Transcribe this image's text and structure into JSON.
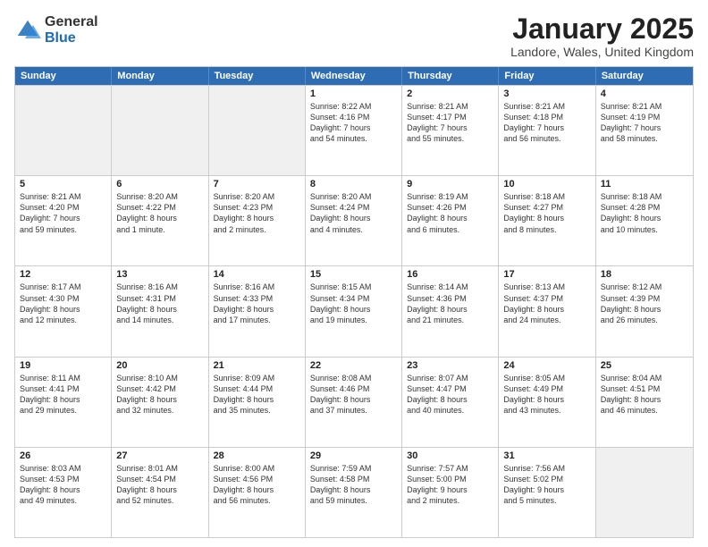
{
  "logo": {
    "general": "General",
    "blue": "Blue"
  },
  "title": "January 2025",
  "location": "Landore, Wales, United Kingdom",
  "days": [
    "Sunday",
    "Monday",
    "Tuesday",
    "Wednesday",
    "Thursday",
    "Friday",
    "Saturday"
  ],
  "weeks": [
    [
      {
        "day": "",
        "text": ""
      },
      {
        "day": "",
        "text": ""
      },
      {
        "day": "",
        "text": ""
      },
      {
        "day": "1",
        "text": "Sunrise: 8:22 AM\nSunset: 4:16 PM\nDaylight: 7 hours\nand 54 minutes."
      },
      {
        "day": "2",
        "text": "Sunrise: 8:21 AM\nSunset: 4:17 PM\nDaylight: 7 hours\nand 55 minutes."
      },
      {
        "day": "3",
        "text": "Sunrise: 8:21 AM\nSunset: 4:18 PM\nDaylight: 7 hours\nand 56 minutes."
      },
      {
        "day": "4",
        "text": "Sunrise: 8:21 AM\nSunset: 4:19 PM\nDaylight: 7 hours\nand 58 minutes."
      }
    ],
    [
      {
        "day": "5",
        "text": "Sunrise: 8:21 AM\nSunset: 4:20 PM\nDaylight: 7 hours\nand 59 minutes."
      },
      {
        "day": "6",
        "text": "Sunrise: 8:20 AM\nSunset: 4:22 PM\nDaylight: 8 hours\nand 1 minute."
      },
      {
        "day": "7",
        "text": "Sunrise: 8:20 AM\nSunset: 4:23 PM\nDaylight: 8 hours\nand 2 minutes."
      },
      {
        "day": "8",
        "text": "Sunrise: 8:20 AM\nSunset: 4:24 PM\nDaylight: 8 hours\nand 4 minutes."
      },
      {
        "day": "9",
        "text": "Sunrise: 8:19 AM\nSunset: 4:26 PM\nDaylight: 8 hours\nand 6 minutes."
      },
      {
        "day": "10",
        "text": "Sunrise: 8:18 AM\nSunset: 4:27 PM\nDaylight: 8 hours\nand 8 minutes."
      },
      {
        "day": "11",
        "text": "Sunrise: 8:18 AM\nSunset: 4:28 PM\nDaylight: 8 hours\nand 10 minutes."
      }
    ],
    [
      {
        "day": "12",
        "text": "Sunrise: 8:17 AM\nSunset: 4:30 PM\nDaylight: 8 hours\nand 12 minutes."
      },
      {
        "day": "13",
        "text": "Sunrise: 8:16 AM\nSunset: 4:31 PM\nDaylight: 8 hours\nand 14 minutes."
      },
      {
        "day": "14",
        "text": "Sunrise: 8:16 AM\nSunset: 4:33 PM\nDaylight: 8 hours\nand 17 minutes."
      },
      {
        "day": "15",
        "text": "Sunrise: 8:15 AM\nSunset: 4:34 PM\nDaylight: 8 hours\nand 19 minutes."
      },
      {
        "day": "16",
        "text": "Sunrise: 8:14 AM\nSunset: 4:36 PM\nDaylight: 8 hours\nand 21 minutes."
      },
      {
        "day": "17",
        "text": "Sunrise: 8:13 AM\nSunset: 4:37 PM\nDaylight: 8 hours\nand 24 minutes."
      },
      {
        "day": "18",
        "text": "Sunrise: 8:12 AM\nSunset: 4:39 PM\nDaylight: 8 hours\nand 26 minutes."
      }
    ],
    [
      {
        "day": "19",
        "text": "Sunrise: 8:11 AM\nSunset: 4:41 PM\nDaylight: 8 hours\nand 29 minutes."
      },
      {
        "day": "20",
        "text": "Sunrise: 8:10 AM\nSunset: 4:42 PM\nDaylight: 8 hours\nand 32 minutes."
      },
      {
        "day": "21",
        "text": "Sunrise: 8:09 AM\nSunset: 4:44 PM\nDaylight: 8 hours\nand 35 minutes."
      },
      {
        "day": "22",
        "text": "Sunrise: 8:08 AM\nSunset: 4:46 PM\nDaylight: 8 hours\nand 37 minutes."
      },
      {
        "day": "23",
        "text": "Sunrise: 8:07 AM\nSunset: 4:47 PM\nDaylight: 8 hours\nand 40 minutes."
      },
      {
        "day": "24",
        "text": "Sunrise: 8:05 AM\nSunset: 4:49 PM\nDaylight: 8 hours\nand 43 minutes."
      },
      {
        "day": "25",
        "text": "Sunrise: 8:04 AM\nSunset: 4:51 PM\nDaylight: 8 hours\nand 46 minutes."
      }
    ],
    [
      {
        "day": "26",
        "text": "Sunrise: 8:03 AM\nSunset: 4:53 PM\nDaylight: 8 hours\nand 49 minutes."
      },
      {
        "day": "27",
        "text": "Sunrise: 8:01 AM\nSunset: 4:54 PM\nDaylight: 8 hours\nand 52 minutes."
      },
      {
        "day": "28",
        "text": "Sunrise: 8:00 AM\nSunset: 4:56 PM\nDaylight: 8 hours\nand 56 minutes."
      },
      {
        "day": "29",
        "text": "Sunrise: 7:59 AM\nSunset: 4:58 PM\nDaylight: 8 hours\nand 59 minutes."
      },
      {
        "day": "30",
        "text": "Sunrise: 7:57 AM\nSunset: 5:00 PM\nDaylight: 9 hours\nand 2 minutes."
      },
      {
        "day": "31",
        "text": "Sunrise: 7:56 AM\nSunset: 5:02 PM\nDaylight: 9 hours\nand 5 minutes."
      },
      {
        "day": "",
        "text": ""
      }
    ]
  ]
}
